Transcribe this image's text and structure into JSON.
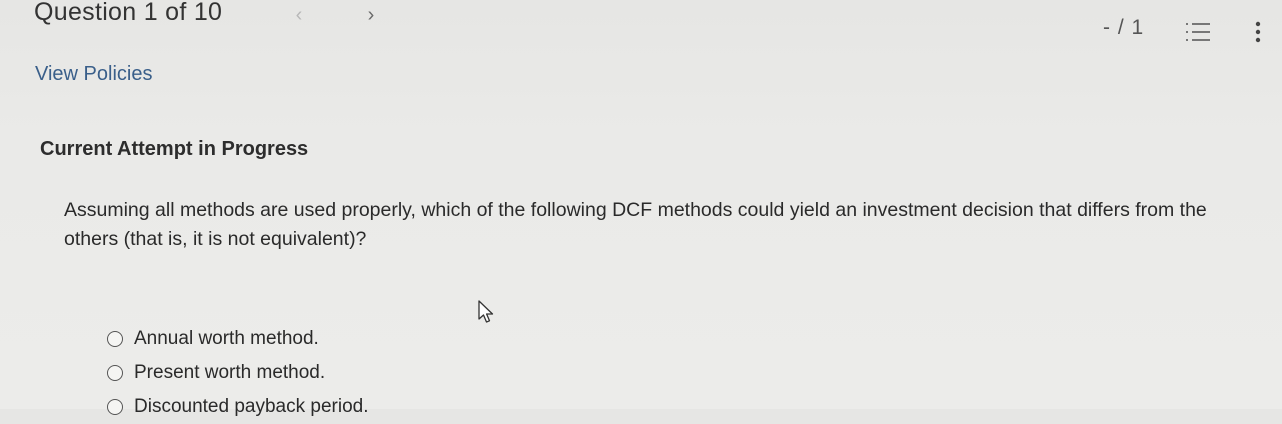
{
  "header": {
    "question_counter": "Question 1 of 10",
    "prev_glyph": "‹",
    "next_glyph": "›",
    "score": "- / 1"
  },
  "links": {
    "view_policies": "View Policies"
  },
  "attempt": {
    "status": "Current Attempt in Progress"
  },
  "question": {
    "text": "Assuming all methods are used properly, which of the following DCF methods could yield an investment decision that differs from the others (that is, it is not equivalent)?",
    "options": [
      {
        "label": "Annual worth method.",
        "selected": false
      },
      {
        "label": "Present worth method.",
        "selected": false
      },
      {
        "label": "Discounted payback period.",
        "selected": false
      }
    ]
  },
  "icons": {
    "prev": "chevron-left-icon",
    "next": "chevron-right-icon",
    "question_list": "numbered-list-icon",
    "more": "vertical-ellipsis-icon",
    "cursor": "mouse-pointer-icon"
  },
  "colors": {
    "link": "#3a5f8a",
    "background": "#eaeae8",
    "text": "#2a2a2a"
  }
}
